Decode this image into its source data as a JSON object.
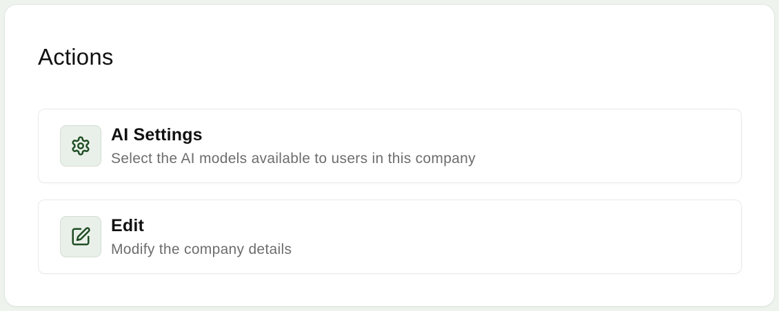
{
  "panel": {
    "title": "Actions"
  },
  "actions": [
    {
      "title": "AI Settings",
      "description": "Select the AI models available to users in this company",
      "icon": "gear-icon"
    },
    {
      "title": "Edit",
      "description": "Modify the company details",
      "icon": "edit-icon"
    }
  ],
  "colors": {
    "icon_stroke": "#1f4d24",
    "icon_bg": "#e9f0e9",
    "page_bg": "#eef3ee",
    "description_text": "#6d6d6d"
  }
}
